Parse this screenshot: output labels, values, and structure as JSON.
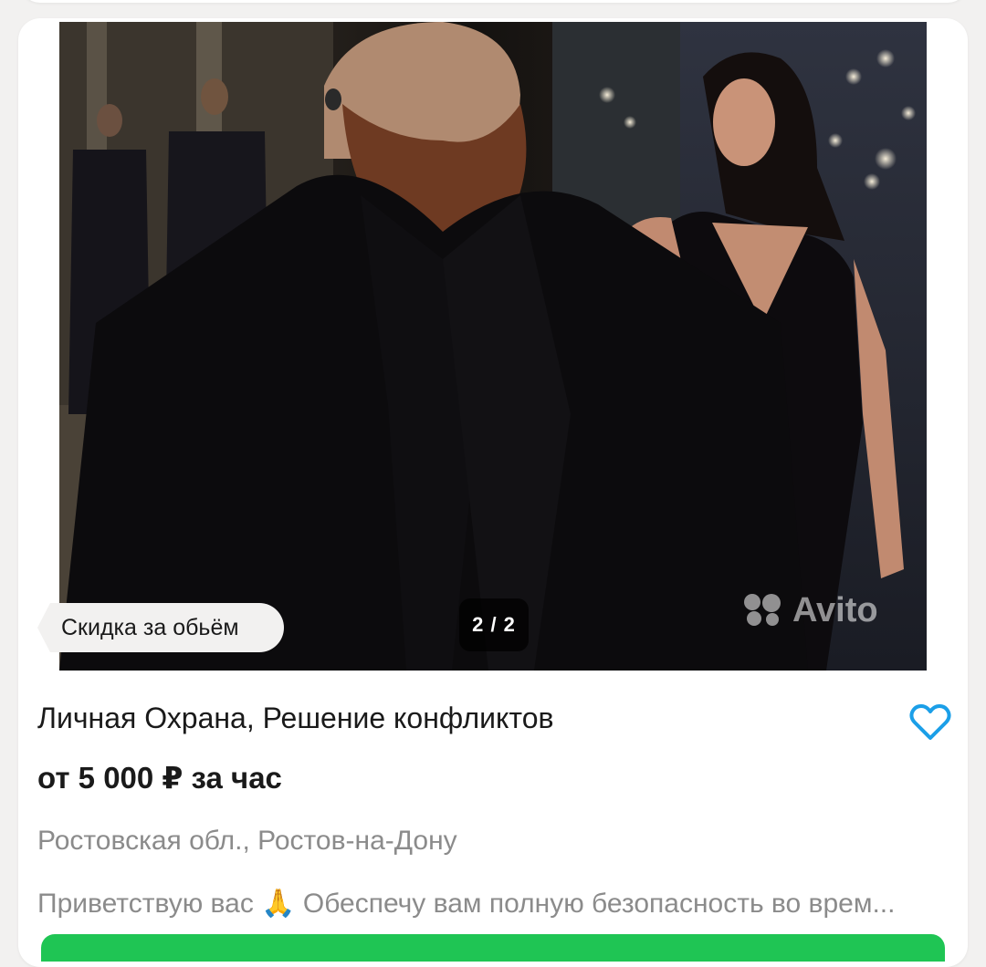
{
  "listing": {
    "discount_tag": "Скидка за обьём",
    "photo_counter": "2 / 2",
    "watermark": "Avito",
    "title": "Личная Охрана, Решение конфликтов",
    "price": "от 5 000 ₽ за час",
    "location": "Ростовская обл., Ростов-на-Дону",
    "description": "Приветствую вас 🙏 Обеспечу вам полную безопасность во врем...",
    "favorite_icon": "heart-outline-icon"
  },
  "colors": {
    "accent_heart": "#1b9fe8",
    "cta_green": "#1fc554",
    "muted_text": "#8b8b8b",
    "page_bg": "#f2f1f0"
  }
}
